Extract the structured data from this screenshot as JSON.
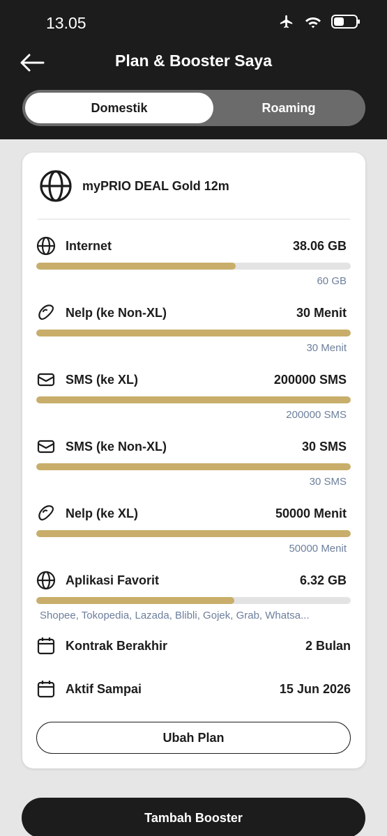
{
  "status_bar": {
    "time": "13.05",
    "icons": [
      "airplane-icon",
      "wifi-icon",
      "battery-icon"
    ]
  },
  "header": {
    "back_icon": "arrow-left-icon",
    "title": "Plan & Booster Saya"
  },
  "tabs": [
    {
      "label": "Domestik",
      "active": true
    },
    {
      "label": "Roaming",
      "active": false
    }
  ],
  "plan": {
    "icon": "globe-icon",
    "name": "myPRIO DEAL Gold 12m"
  },
  "quotas": [
    {
      "icon": "globe-icon",
      "label": "Internet",
      "remaining": "38.06 GB",
      "total": "60 GB",
      "fill_fraction": 0.634
    },
    {
      "icon": "phone-icon",
      "label": "Nelp (ke Non-XL)",
      "remaining": "30 Menit",
      "total": "30 Menit",
      "fill_fraction": 1.0
    },
    {
      "icon": "message-icon",
      "label": "SMS (ke XL)",
      "remaining": "200000 SMS",
      "total": "200000 SMS",
      "fill_fraction": 1.0
    },
    {
      "icon": "message-icon",
      "label": "SMS (ke Non-XL)",
      "remaining": "30 SMS",
      "total": "30 SMS",
      "fill_fraction": 1.0
    },
    {
      "icon": "phone-icon",
      "label": "Nelp (ke XL)",
      "remaining": "50000 Menit",
      "total": "50000 Menit",
      "fill_fraction": 1.0
    },
    {
      "icon": "globe-icon",
      "label": "Aplikasi Favorit",
      "remaining": "6.32 GB",
      "apps": "Shopee, Tokopedia, Lazada, Blibli, Gojek, Grab, Whatsa...",
      "fill_fraction": 0.63
    }
  ],
  "info": [
    {
      "icon": "calendar-icon",
      "label": "Kontrak Berakhir",
      "value": "2 Bulan"
    },
    {
      "icon": "calendar-icon",
      "label": "Aktif Sampai",
      "value": "15 Jun 2026"
    }
  ],
  "buttons": {
    "change_plan": "Ubah Plan",
    "add_booster": "Tambah Booster"
  },
  "colors": {
    "bar_fill": "#c8ae6a",
    "bar_track": "#e3e3e3",
    "header_bg": "#1c1c1c",
    "muted_text": "#6d7f9c"
  }
}
